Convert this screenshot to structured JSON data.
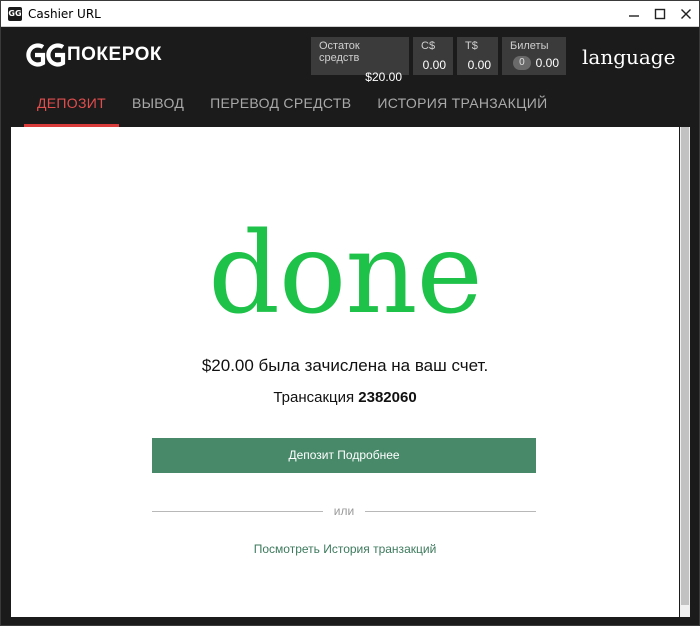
{
  "window": {
    "title": "Cashier URL"
  },
  "header": {
    "logo_text": "ПОКЕРОК",
    "language": "language",
    "balances": {
      "main": {
        "label": "Остаток средств",
        "value": "$20.00"
      },
      "cs": {
        "label": "C$",
        "value": "0.00"
      },
      "ts": {
        "label": "T$",
        "value": "0.00"
      },
      "tickets": {
        "label": "Билеты",
        "count": "0",
        "value": "0.00"
      }
    }
  },
  "tabs": [
    {
      "label": "ДЕПОЗИТ",
      "active": true
    },
    {
      "label": "ВЫВОД",
      "active": false
    },
    {
      "label": "ПЕРЕВОД СРЕДСТВ",
      "active": false
    },
    {
      "label": "ИСТОРИЯ ТРАНЗАКЦИЙ",
      "active": false
    }
  ],
  "main": {
    "status_word": "done",
    "credited_text": "$20.00 была зачислена на ваш счет.",
    "transaction_label": "Трансакция",
    "transaction_id": "2382060",
    "details_button": "Депозит Подробнее",
    "or_text": "или",
    "history_link": "Посмотреть История транзакций"
  },
  "colors": {
    "accent_red": "#d93a3a",
    "success_green": "#1fc249",
    "button_green": "#48896a",
    "link_green": "#3d7a5d"
  }
}
